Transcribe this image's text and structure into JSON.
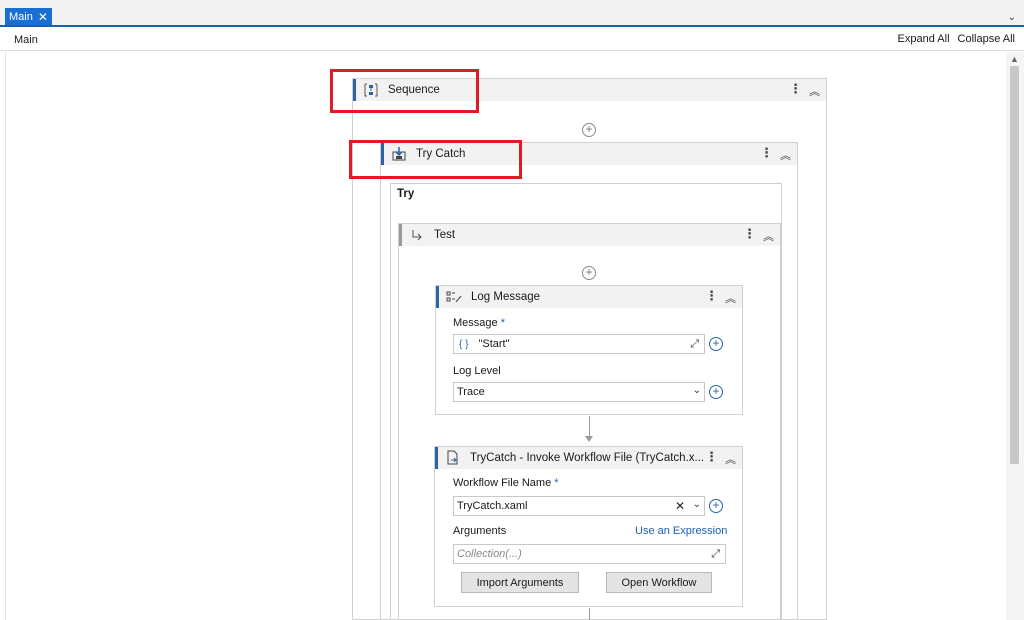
{
  "tab": {
    "label": "Main",
    "close": "✕",
    "dropdown": "⌄"
  },
  "breadcrumb": {
    "item": "Main",
    "expand_all": "Expand All",
    "collapse_all": "Collapse All"
  },
  "sequence": {
    "title": "Sequence",
    "icon": "sequence-icon"
  },
  "try_catch": {
    "title": "Try Catch",
    "icon": "try-catch-icon",
    "try_label": "Try"
  },
  "test": {
    "title": "Test",
    "icon": "branch-arrow-icon"
  },
  "log_message": {
    "title": "Log Message",
    "icon": "log-message-icon",
    "message_label": "Message",
    "required_mark": "*",
    "message_value": "\"Start\"",
    "log_level_label": "Log Level",
    "log_level_value": "Trace"
  },
  "invoke": {
    "title": "TryCatch - Invoke Workflow File (TryCatch.x...",
    "icon": "invoke-workflow-icon",
    "file_label": "Workflow File Name",
    "required_mark": "*",
    "file_value": "TryCatch.xaml",
    "arguments_label": "Arguments",
    "use_expression": "Use an Expression",
    "collection_placeholder": "Collection(...)",
    "import_button": "Import Arguments",
    "open_button": "Open Workflow"
  },
  "glyphs": {
    "menu": "⋮",
    "collapse": "︽",
    "plus": "+",
    "chevron": "⌄",
    "clear": "✕",
    "expand": "⤢",
    "braces": "{ }"
  },
  "colors": {
    "accent": "#1a6fd4",
    "highlight": "#e01b24"
  }
}
